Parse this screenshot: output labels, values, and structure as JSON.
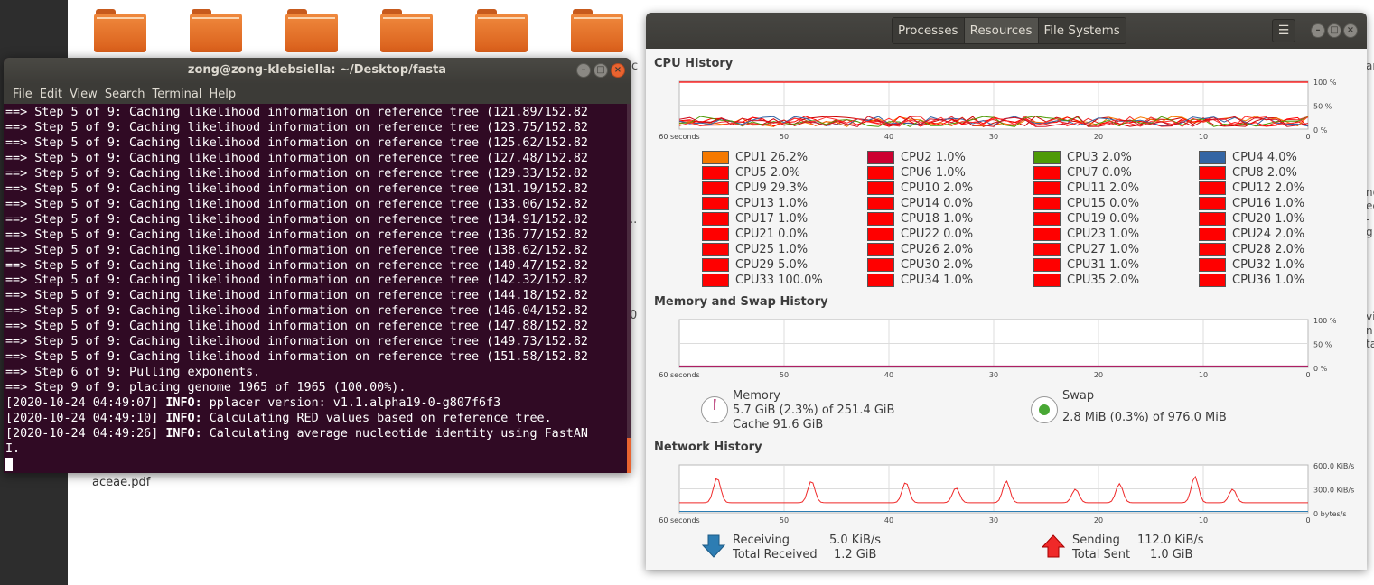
{
  "desktop": {
    "file_label": "aceae.pdf",
    "frag_c": "c",
    "frag_dots": "..",
    "frag_zero": "0",
    "right_frags": [
      "ng",
      "ec",
      "-g",
      "vi",
      "n",
      "ta",
      "ar"
    ]
  },
  "terminal": {
    "title": "zong@zong-klebsiella: ~/Desktop/fasta",
    "menu": [
      "File",
      "Edit",
      "View",
      "Search",
      "Terminal",
      "Help"
    ],
    "lines": [
      {
        "prefix": "",
        "bold": "",
        "text": "==> Step 5 of 9: Caching likelihood information on reference tree (121.89/152.82"
      },
      {
        "prefix": "",
        "bold": "",
        "text": "==> Step 5 of 9: Caching likelihood information on reference tree (123.75/152.82"
      },
      {
        "prefix": "",
        "bold": "",
        "text": "==> Step 5 of 9: Caching likelihood information on reference tree (125.62/152.82"
      },
      {
        "prefix": "",
        "bold": "",
        "text": "==> Step 5 of 9: Caching likelihood information on reference tree (127.48/152.82"
      },
      {
        "prefix": "",
        "bold": "",
        "text": "==> Step 5 of 9: Caching likelihood information on reference tree (129.33/152.82"
      },
      {
        "prefix": "",
        "bold": "",
        "text": "==> Step 5 of 9: Caching likelihood information on reference tree (131.19/152.82"
      },
      {
        "prefix": "",
        "bold": "",
        "text": "==> Step 5 of 9: Caching likelihood information on reference tree (133.06/152.82"
      },
      {
        "prefix": "",
        "bold": "",
        "text": "==> Step 5 of 9: Caching likelihood information on reference tree (134.91/152.82"
      },
      {
        "prefix": "",
        "bold": "",
        "text": "==> Step 5 of 9: Caching likelihood information on reference tree (136.77/152.82"
      },
      {
        "prefix": "",
        "bold": "",
        "text": "==> Step 5 of 9: Caching likelihood information on reference tree (138.62/152.82"
      },
      {
        "prefix": "",
        "bold": "",
        "text": "==> Step 5 of 9: Caching likelihood information on reference tree (140.47/152.82"
      },
      {
        "prefix": "",
        "bold": "",
        "text": "==> Step 5 of 9: Caching likelihood information on reference tree (142.32/152.82"
      },
      {
        "prefix": "",
        "bold": "",
        "text": "==> Step 5 of 9: Caching likelihood information on reference tree (144.18/152.82"
      },
      {
        "prefix": "",
        "bold": "",
        "text": "==> Step 5 of 9: Caching likelihood information on reference tree (146.04/152.82"
      },
      {
        "prefix": "",
        "bold": "",
        "text": "==> Step 5 of 9: Caching likelihood information on reference tree (147.88/152.82"
      },
      {
        "prefix": "",
        "bold": "",
        "text": "==> Step 5 of 9: Caching likelihood information on reference tree (149.73/152.82"
      },
      {
        "prefix": "",
        "bold": "",
        "text": "==> Step 5 of 9: Caching likelihood information on reference tree (151.58/152.82"
      },
      {
        "prefix": "",
        "bold": "",
        "text": "==> Step 6 of 9: Pulling exponents."
      },
      {
        "prefix": "",
        "bold": "",
        "text": "==> Step 9 of 9: placing genome 1965 of 1965 (100.00%)."
      },
      {
        "prefix": "[2020-10-24 04:49:07] ",
        "bold": "INFO:",
        "text": " pplacer version: v1.1.alpha19-0-g807f6f3"
      },
      {
        "prefix": "[2020-10-24 04:49:10] ",
        "bold": "INFO:",
        "text": " Calculating RED values based on reference tree."
      },
      {
        "prefix": "[2020-10-24 04:49:26] ",
        "bold": "INFO:",
        "text": " Calculating average nucleotide identity using FastAN"
      },
      {
        "prefix": "",
        "bold": "",
        "text": "I."
      }
    ]
  },
  "sysmon": {
    "tabs": [
      "Processes",
      "Resources",
      "File Systems"
    ],
    "active_tab": "Resources",
    "menu_icon": "hamburger-icon",
    "sections": {
      "cpu": "CPU History",
      "memory": "Memory and Swap History",
      "network": "Network History"
    },
    "x_axis": [
      "60 seconds",
      "50",
      "40",
      "30",
      "20",
      "10",
      "0"
    ],
    "y_axis_percent": [
      "100 %",
      "50 %",
      "0 %"
    ],
    "y_axis_network": [
      "600.0 KiB/s",
      "300.0 KiB/s",
      "0 bytes/s"
    ],
    "cpus": [
      {
        "label": "CPU1",
        "value": "26.2%",
        "color": "#f57900"
      },
      {
        "label": "CPU2",
        "value": "1.0%",
        "color": "#cc0030"
      },
      {
        "label": "CPU3",
        "value": "2.0%",
        "color": "#4e9a06"
      },
      {
        "label": "CPU4",
        "value": "4.0%",
        "color": "#3465a4"
      },
      {
        "label": "CPU5",
        "value": "2.0%",
        "color": "#ff0000"
      },
      {
        "label": "CPU6",
        "value": "1.0%",
        "color": "#ff0000"
      },
      {
        "label": "CPU7",
        "value": "0.0%",
        "color": "#ff0000"
      },
      {
        "label": "CPU8",
        "value": "2.0%",
        "color": "#ff0000"
      },
      {
        "label": "CPU9",
        "value": "29.3%",
        "color": "#ff0000"
      },
      {
        "label": "CPU10",
        "value": "2.0%",
        "color": "#ff0000"
      },
      {
        "label": "CPU11",
        "value": "2.0%",
        "color": "#ff0000"
      },
      {
        "label": "CPU12",
        "value": "2.0%",
        "color": "#ff0000"
      },
      {
        "label": "CPU13",
        "value": "1.0%",
        "color": "#ff0000"
      },
      {
        "label": "CPU14",
        "value": "0.0%",
        "color": "#ff0000"
      },
      {
        "label": "CPU15",
        "value": "0.0%",
        "color": "#ff0000"
      },
      {
        "label": "CPU16",
        "value": "1.0%",
        "color": "#ff0000"
      },
      {
        "label": "CPU17",
        "value": "1.0%",
        "color": "#ff0000"
      },
      {
        "label": "CPU18",
        "value": "1.0%",
        "color": "#ff0000"
      },
      {
        "label": "CPU19",
        "value": "0.0%",
        "color": "#ff0000"
      },
      {
        "label": "CPU20",
        "value": "1.0%",
        "color": "#ff0000"
      },
      {
        "label": "CPU21",
        "value": "0.0%",
        "color": "#ff0000"
      },
      {
        "label": "CPU22",
        "value": "0.0%",
        "color": "#ff0000"
      },
      {
        "label": "CPU23",
        "value": "1.0%",
        "color": "#ff0000"
      },
      {
        "label": "CPU24",
        "value": "2.0%",
        "color": "#ff0000"
      },
      {
        "label": "CPU25",
        "value": "1.0%",
        "color": "#ff0000"
      },
      {
        "label": "CPU26",
        "value": "2.0%",
        "color": "#ff0000"
      },
      {
        "label": "CPU27",
        "value": "1.0%",
        "color": "#ff0000"
      },
      {
        "label": "CPU28",
        "value": "2.0%",
        "color": "#ff0000"
      },
      {
        "label": "CPU29",
        "value": "5.0%",
        "color": "#ff0000"
      },
      {
        "label": "CPU30",
        "value": "2.0%",
        "color": "#ff0000"
      },
      {
        "label": "CPU31",
        "value": "1.0%",
        "color": "#ff0000"
      },
      {
        "label": "CPU32",
        "value": "1.0%",
        "color": "#ff0000"
      },
      {
        "label": "CPU33",
        "value": "100.0%",
        "color": "#ff0000"
      },
      {
        "label": "CPU34",
        "value": "1.0%",
        "color": "#ff0000"
      },
      {
        "label": "CPU35",
        "value": "2.0%",
        "color": "#ff0000"
      },
      {
        "label": "CPU36",
        "value": "1.0%",
        "color": "#ff0000"
      }
    ],
    "memory": {
      "title": "Memory",
      "usage": "5.7 GiB (2.3%) of 251.4 GiB",
      "cache": "Cache 91.6 GiB",
      "color": "#ad1f63"
    },
    "swap": {
      "title": "Swap",
      "usage": "2.8 MiB (0.3%) of 976.0 MiB",
      "color": "#49a835"
    },
    "network": {
      "receiving_label": "Receiving",
      "receiving_value": "5.0 KiB/s",
      "total_received_label": "Total Received",
      "total_received_value": "1.2 GiB",
      "sending_label": "Sending",
      "sending_value": "112.0 KiB/s",
      "total_sent_label": "Total Sent",
      "total_sent_value": "1.0 GiB",
      "receiving_color": "#2d7db3",
      "sending_color": "#ef2929"
    }
  }
}
